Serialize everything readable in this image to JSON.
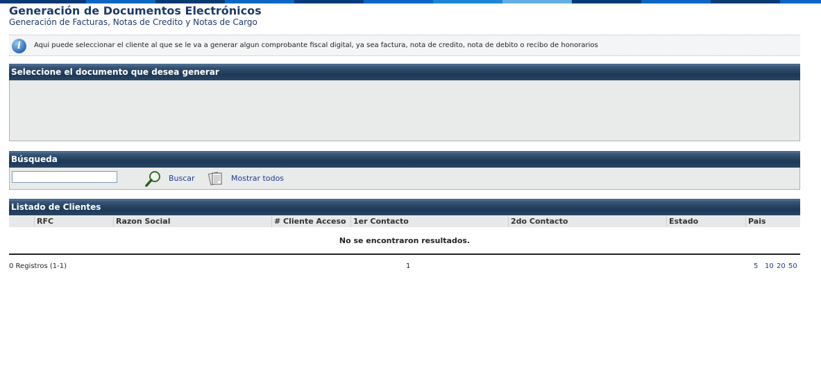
{
  "header": {
    "title": "Generación de Documentos Electrónicos",
    "subtitle": "Generación de Facturas, Notas de Credito y Notas de Cargo"
  },
  "info": {
    "icon": "info-icon",
    "text": "Aqui puede seleccionar el cliente al que se le va a generar algun comprobante fiscal digital, ya sea factura, nota de credito, nota de debito o recibo de honorarios"
  },
  "document_panel": {
    "title": "Seleccione el documento que desea generar"
  },
  "search_panel": {
    "title": "Búsqueda",
    "input_value": "",
    "search_label": "Buscar",
    "show_all_label": "Mostrar todos"
  },
  "clients_panel": {
    "title": "Listado de Clientes",
    "columns": [
      "RFC",
      "Razon Social",
      "# Cliente Acceso",
      "1er Contacto",
      "2do Contacto",
      "Estado",
      "Pais"
    ],
    "empty_message": "No se encontraron resultados."
  },
  "pagination": {
    "records": "0 Registros (1-1)",
    "current_page": "1",
    "page_sizes": [
      "5",
      "10",
      "20",
      "50"
    ]
  },
  "colors": {
    "title": "#1c3a6b",
    "panel_header": "#1d3957",
    "panel_body": "#e9eaea",
    "link": "#1c3a8b"
  }
}
